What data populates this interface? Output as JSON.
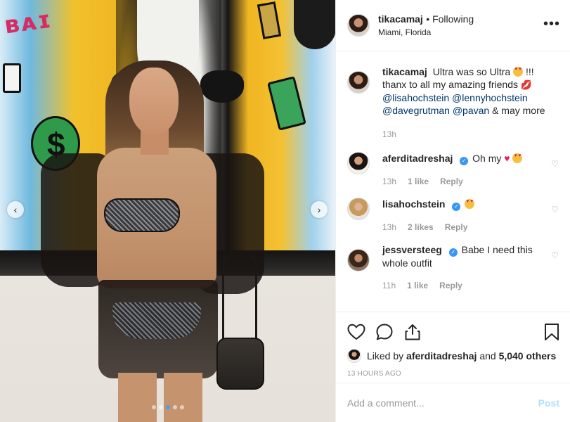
{
  "post": {
    "username": "tikacamaj",
    "following": "• Following",
    "location": "Miami, Florida",
    "more": "•••"
  },
  "caption": {
    "username": "tikacamaj",
    "text_1": "Ultra was so Ultra",
    "text_2": "!!!",
    "text_3": "thanx to all my amazing friends",
    "mentions": [
      "@lisahochstein",
      "@lennyhochstein",
      "@davegrutman",
      "@pavan"
    ],
    "text_end": "& may more",
    "time": "13h"
  },
  "comments": [
    {
      "username": "aferditadreshaj",
      "verified": true,
      "text": "Oh my",
      "time": "13h",
      "likes": "1 like",
      "reply": "Reply"
    },
    {
      "username": "lisahochstein",
      "verified": true,
      "text": "",
      "time": "13h",
      "likes": "2 likes",
      "reply": "Reply"
    },
    {
      "username": "jessversteeg",
      "verified": true,
      "text": "Babe I need this whole outfit",
      "time": "11h",
      "likes": "1 like",
      "reply": "Reply"
    }
  ],
  "likes": {
    "prefix": "Liked by",
    "user": "aferditadreshaj",
    "joiner": "and",
    "others": "5,040 others"
  },
  "timestamp": "13 HOURS AGO",
  "add_comment": {
    "placeholder": "Add a comment...",
    "post_label": "Post"
  },
  "carousel": {
    "slides": 5,
    "active": 2
  },
  "colors": {
    "mention": "#003569",
    "verified": "#3897f0",
    "post_disabled": "#b2dffc",
    "active_dot": "#4da0ef"
  }
}
